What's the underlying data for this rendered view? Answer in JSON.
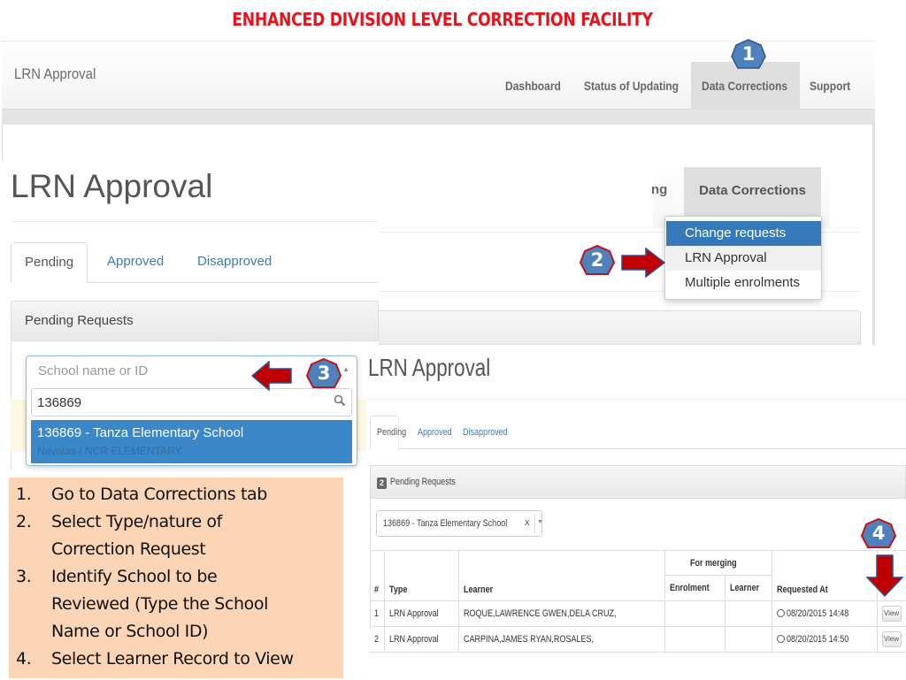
{
  "slide_title": "ENHANCED DIVISION LEVEL CORRECTION FACILITY",
  "navbar": {
    "brand": "LRN Approval",
    "items": [
      {
        "label": "Dashboard"
      },
      {
        "label": "Status of Updating"
      },
      {
        "label": "Data Corrections",
        "active": true
      },
      {
        "label": "Support"
      }
    ]
  },
  "zoomed_page": {
    "title": "LRN Approval",
    "tabs": [
      {
        "label": "Pending",
        "active": true
      },
      {
        "label": "Approved"
      },
      {
        "label": "Disapproved"
      }
    ],
    "panel_title": "Pending Requests",
    "school_select": {
      "placeholder": "School name or ID",
      "search_value": "136869",
      "result_title": "136869 - Tanza Elementary School",
      "result_subtitle": "Navotas / NCR ELEMENTARY"
    }
  },
  "menu": {
    "partial_nav_label": "ng",
    "tab_label": "Data Corrections",
    "items": [
      {
        "label": "Change requests",
        "active": true
      },
      {
        "label": "LRN Approval"
      },
      {
        "label": "Multiple enrolments"
      }
    ]
  },
  "result_page": {
    "title": "LRN Approval",
    "tabs": [
      {
        "label": "Pending",
        "active": true
      },
      {
        "label": "Approved"
      },
      {
        "label": "Disapproved"
      }
    ],
    "pending_count": "2",
    "panel_title": "Pending Requests",
    "selected_school": "136869 - Tanza Elementary School",
    "clear_symbol": "x",
    "table": {
      "group_header": "For merging",
      "columns": [
        "#",
        "Type",
        "Learner",
        "Enrolment",
        "Learner",
        "Requested At",
        ""
      ],
      "rows": [
        {
          "num": "1",
          "type": "LRN Approval",
          "learner": "ROQUE,LAWRENCE GWEN,DELA CRUZ,",
          "enrolment": "",
          "merge_learner": "",
          "requested_at": "08/20/2015 14:48",
          "action": "View"
        },
        {
          "num": "2",
          "type": "LRN Approval",
          "learner": "CARPINA,JAMES RYAN,ROSALES,",
          "enrolment": "",
          "merge_learner": "",
          "requested_at": "08/20/2015 14:50",
          "action": "View"
        }
      ]
    }
  },
  "instructions": [
    {
      "num": "1.",
      "text": "Go to Data Corrections tab"
    },
    {
      "num": "2.",
      "text": "Select Type/nature of"
    },
    {
      "num": "",
      "text": "Correction Request"
    },
    {
      "num": "3.",
      "text": "Identify School to be"
    },
    {
      "num": "",
      "text": "Reviewed (Type the School"
    },
    {
      "num": "",
      "text": "Name or School ID)"
    },
    {
      "num": "4.",
      "text": "Select Learner Record to View"
    }
  ],
  "markers": [
    {
      "label": "1"
    },
    {
      "label": "2"
    },
    {
      "label": "3"
    },
    {
      "label": "4"
    }
  ],
  "colors": {
    "title_red": "#e8121b",
    "marker_fill": "#4f81bd",
    "marker_border": "#c0141c",
    "arrow_red": "#c00000",
    "highlight_blue": "#3679b8",
    "link_blue": "#3d7ab8",
    "instructions_bg": "#fbd5b5"
  }
}
